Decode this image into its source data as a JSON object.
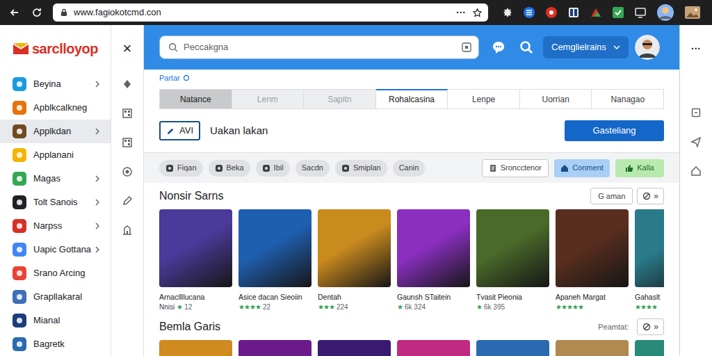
{
  "browser": {
    "url": "www.fagiokotcmd.con",
    "menu": "···"
  },
  "logo": {
    "text": "sarclloyop"
  },
  "panel": {
    "close": "×"
  },
  "right_rail": {
    "menu": "···"
  },
  "sidebar": {
    "items": [
      {
        "label": "Beyina",
        "color": "#1a9be0",
        "chevron": true,
        "selected": false
      },
      {
        "label": "Apblkcalkneg",
        "color": "#e8710a",
        "chevron": false,
        "selected": false
      },
      {
        "label": "Applkdan",
        "color": "#6d4c1f",
        "chevron": true,
        "selected": true
      },
      {
        "label": "Applanani",
        "color": "#f4b400",
        "chevron": false,
        "selected": false
      },
      {
        "label": "Magas",
        "color": "#34a853",
        "chevron": true,
        "selected": false
      },
      {
        "label": "Tolt Sanois",
        "color": "#202124",
        "chevron": true,
        "selected": false
      },
      {
        "label": "Narpss",
        "color": "#d93025",
        "chevron": true,
        "selected": false
      },
      {
        "label": "Uapic Gottana",
        "color": "#4285f4",
        "chevron": true,
        "selected": false
      },
      {
        "label": "Srano Arcing",
        "color": "#ea4335",
        "chevron": false,
        "selected": false
      },
      {
        "label": "Grapllakaral",
        "color": "#3f6fb5",
        "chevron": false,
        "selected": false
      },
      {
        "label": "Mianal",
        "color": "#1a3d7c",
        "chevron": false,
        "selected": false
      },
      {
        "label": "Bagretk",
        "color": "#2b6cb0",
        "chevron": false,
        "selected": false
      }
    ]
  },
  "header": {
    "search": {
      "placeholder": "Peccakgna"
    },
    "account": "Cemglielrains"
  },
  "breadcrumb": "Partar",
  "tabs": [
    {
      "label": "Natance",
      "selected": false,
      "shaded": true,
      "disabled": false
    },
    {
      "label": "Lenm",
      "selected": false,
      "shaded": false,
      "disabled": true
    },
    {
      "label": "Sapitn",
      "selected": false,
      "shaded": false,
      "disabled": true
    },
    {
      "label": "Rohalcasina",
      "selected": true,
      "shaded": false,
      "disabled": false
    },
    {
      "label": "Lenpe",
      "selected": false,
      "shaded": false,
      "disabled": false
    },
    {
      "label": "Uorrian",
      "selected": false,
      "shaded": false,
      "disabled": false
    },
    {
      "label": "Nanagao",
      "selected": false,
      "shaded": false,
      "disabled": false
    }
  ],
  "action_row": {
    "tool": "AVI",
    "text": "Uakan lakan",
    "primary": "Gasteliang"
  },
  "filters": {
    "chips": [
      {
        "label": "Fiqan",
        "kind": "icon"
      },
      {
        "label": "Beka",
        "kind": "icon"
      },
      {
        "label": "Ibil",
        "kind": "icon"
      },
      {
        "label": "Sacdn",
        "kind": "plain"
      },
      {
        "label": "Smiplan",
        "kind": "icon"
      },
      {
        "label": "Canin",
        "kind": "plain"
      }
    ],
    "buttons": [
      {
        "label": "Sroncctenor",
        "kind": "outline"
      },
      {
        "label": "Conment",
        "kind": "blue"
      },
      {
        "label": "Kalla",
        "kind": "green"
      }
    ]
  },
  "sections": [
    {
      "title": "Nonsir Sarns",
      "control": "G aman",
      "nav": "»",
      "games": [
        {
          "title": "Arnacllllucana",
          "prefix": "Nnisi",
          "stars": 1,
          "count": "12",
          "color": "#4a3a9a"
        },
        {
          "title": "Asice dacan Sieoiin",
          "stars": 4,
          "count": "22",
          "color": "#1f5fb0"
        },
        {
          "title": "Dentah",
          "stars": 3,
          "count": "224",
          "color": "#c98a1e"
        },
        {
          "title": "Gaunsh STaitein",
          "stars": 1,
          "count": "6k 324",
          "color": "#8a2fc0"
        },
        {
          "title": "Tvasit Pieonia",
          "stars": 1,
          "count": "6k 395",
          "color": "#4a6a2a"
        },
        {
          "title": "Apaneh Margat",
          "stars": 5,
          "color": "#5a2e1e"
        },
        {
          "title": "Gahaslt",
          "stars": 4,
          "color": "#2a7a8a"
        }
      ]
    },
    {
      "title": "Bemla Garis",
      "note": "Peamtat:",
      "nav": "»",
      "games": [
        {
          "color": "#d08a20"
        },
        {
          "color": "#6a1a8a"
        },
        {
          "color": "#3a1a70"
        },
        {
          "color": "#c02a80"
        },
        {
          "color": "#2a6ab0"
        },
        {
          "color": "#b08a50"
        },
        {
          "color": "#2a8a7a"
        }
      ]
    }
  ]
}
